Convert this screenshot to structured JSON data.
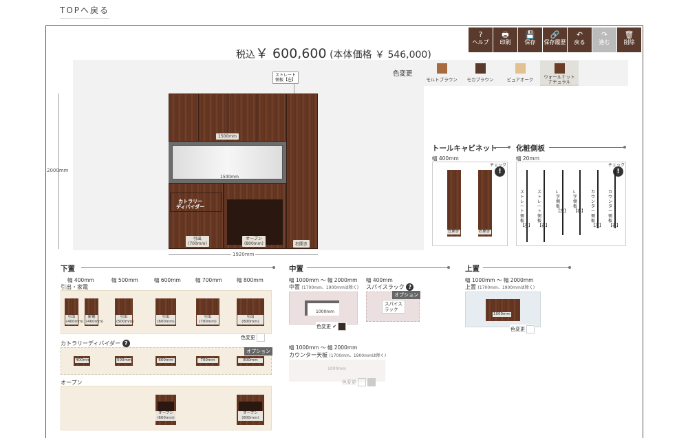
{
  "nav": {
    "back": "TOPへ戻る"
  },
  "toolbar": [
    {
      "label": "ヘルプ",
      "icon": "?"
    },
    {
      "label": "印刷",
      "icon": "🖶"
    },
    {
      "label": "保存",
      "icon": "💾"
    },
    {
      "label": "保存履歴",
      "icon": "🔗"
    },
    {
      "label": "戻る",
      "icon": "↶"
    },
    {
      "label": "進む",
      "icon": "↷"
    },
    {
      "label": "削除",
      "icon": "🗑"
    }
  ],
  "price": {
    "prefix": "税込",
    "amount": "￥ 600,600",
    "detail": "(本体価格 ￥ 546,000)"
  },
  "color": {
    "label": "色変更",
    "options": [
      {
        "name": "モルトブラウン",
        "hex": "#a86a3f"
      },
      {
        "name": "モカブラウン",
        "hex": "#5b3a2e"
      },
      {
        "name": "ピュアオーク",
        "hex": "#e2c08f"
      },
      {
        "name": "ウォールナット\nナチュラル",
        "hex": "#6a3c28"
      }
    ]
  },
  "cabinet": {
    "height": "2000mm",
    "width": "1920mm",
    "side_panel_tag": "ストレート\n側板【左】",
    "upper_width": "1500mm",
    "middle_width": "1500mm",
    "cutlery": "カトラリー\nディバイダー",
    "drawer": "引出\n(700mm)",
    "open": "オープン\n(800mm)",
    "right_open": "右開き"
  },
  "tall": {
    "title": "トールキャビネット",
    "width": "幅 400mm",
    "check": "チェック",
    "left": "左開き",
    "right": "右開き"
  },
  "side": {
    "title": "化粧側板",
    "width": "幅 20mm",
    "check": "チェック",
    "items": [
      "ストレート側板【左】",
      "ストレート側板【右】",
      "L字側板【左】",
      "L字側板【右】",
      "カウンター側板【左】",
      "カウンター側板【右】"
    ]
  },
  "lower": {
    "title": "下置",
    "widths": [
      "幅 400mm",
      "幅 500mm",
      "幅 600mm",
      "幅 700mm",
      "幅 800mm"
    ],
    "drawer": {
      "label": "引出・家電",
      "items": [
        "引出\n(400mm)",
        "家電\n(400mm)",
        "引出\n(500mm)",
        "引出\n(600mm)",
        "引出\n(700mm)",
        "引出\n(800mm)"
      ],
      "color": "色変更"
    },
    "cutlery": {
      "label": "カトラリーディバイダー",
      "option": "オプション",
      "items": [
        "400mm",
        "500mm",
        "600mm",
        "700mm",
        "800mm"
      ]
    },
    "open": {
      "label": "オープン",
      "items": [
        "オープン\n(600mm)",
        "オープン\n(800mm)"
      ]
    }
  },
  "middle": {
    "title": "中置",
    "range": "幅 1000mm 〜 幅 2000mm",
    "chuo": "中置",
    "note": "(1700mm、1900mmは除く)",
    "chuo_size": "1000mm",
    "color": "色変更",
    "spice": {
      "width": "幅 400mm",
      "label": "スパイスラック",
      "option": "オプション",
      "item": "スパイス\nラック"
    },
    "counter": {
      "range": "幅 1000mm 〜 幅 2000mm",
      "label": "カウンター天板",
      "note": "(1700mm、1900mmは除く)",
      "size": "1000mm",
      "color": "色変更"
    }
  },
  "upper": {
    "title": "上置",
    "range": "幅 1000mm 〜 幅 2000mm",
    "label": "上置",
    "note": "(1700mm、1900mmは除く)",
    "size": "1000mm",
    "color": "色変更"
  }
}
